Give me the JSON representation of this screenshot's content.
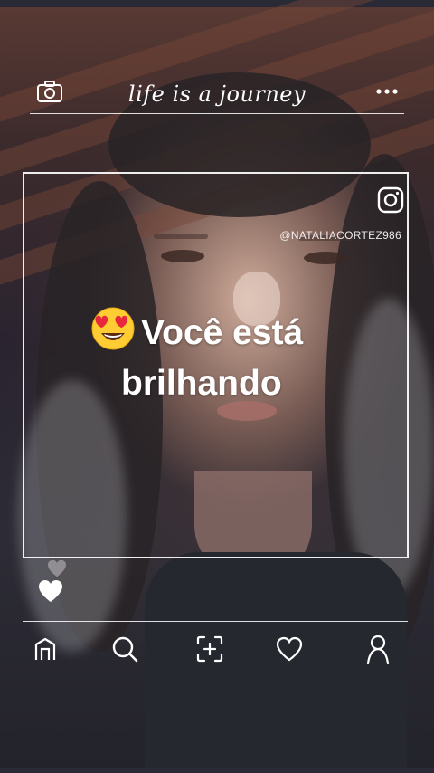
{
  "header": {
    "title": "life is a journey",
    "camera_icon": "camera-icon",
    "more_icon": "more-dots-icon"
  },
  "post": {
    "instagram_icon": "instagram-icon",
    "username": "@NATALIACORTEZ986",
    "caption_emoji": "heart-eyes-emoji",
    "caption_line1": "Você está",
    "caption_line2": "brilhando",
    "like_icon": "heart-icon"
  },
  "nav": {
    "items": [
      {
        "icon": "home-icon"
      },
      {
        "icon": "search-icon"
      },
      {
        "icon": "add-post-icon"
      },
      {
        "icon": "heart-outline-icon"
      },
      {
        "icon": "profile-icon"
      }
    ]
  },
  "colors": {
    "overlay_line": "#ffffff",
    "caption_text": "#ffffff"
  }
}
